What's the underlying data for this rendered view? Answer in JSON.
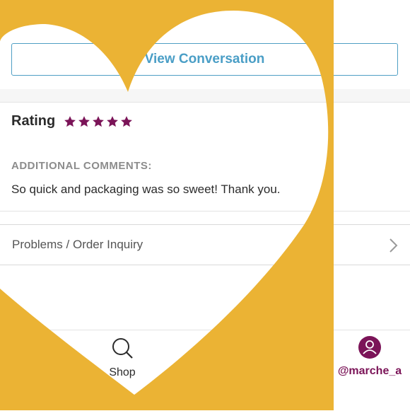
{
  "order": {
    "view_conversation_label": "View Conversation",
    "rating_label": "Rating",
    "rating_stars": 5,
    "additional_comments_heading": "ADDITIONAL COMMENTS:",
    "comment_text": "So quick and packaging was so sweet! Thank you.",
    "problems_label": "Problems / Order Inquiry"
  },
  "tabbar": {
    "shop_label": "Shop",
    "profile_label": "@marche_a"
  },
  "colors": {
    "accent": "#7b1458",
    "link_blue": "#4a9ec6",
    "overlay_yellow": "#ebb334"
  },
  "icons": {
    "star": "star-icon",
    "chevron": "chevron-right-icon",
    "search": "search-icon",
    "profile": "user-icon",
    "overlay": "heart-frame"
  }
}
